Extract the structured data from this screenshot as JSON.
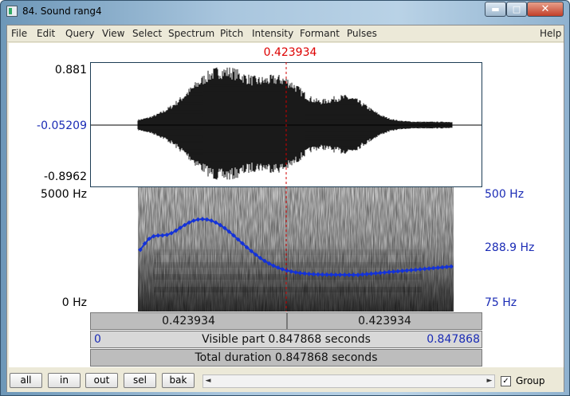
{
  "window": {
    "title": "84. Sound rang4",
    "minimize": "▬",
    "maximize": "□",
    "close": "✕"
  },
  "menu": [
    "File",
    "Edit",
    "Query",
    "View",
    "Select",
    "Spectrum",
    "Pitch",
    "Intensity",
    "Formant",
    "Pulses",
    "Help"
  ],
  "editor": {
    "cursor_time": "0.423934",
    "wave_max": "0.881",
    "wave_mid": "-0.05209",
    "wave_min": "-0.8962",
    "spec_top": "5000 Hz",
    "spec_bottom": "0 Hz",
    "pitch_top": "500 Hz",
    "pitch_mid": "288.9 Hz",
    "pitch_bottom": "75 Hz",
    "cursor_fraction": 0.5,
    "sound_start_fraction": 0.12,
    "sound_end_fraction": 0.925,
    "colors": {
      "cursor": "#d00000",
      "pitch": "#1432d8",
      "axis_right": "#1a2bb5"
    }
  },
  "bars": {
    "left_segment": "0.423934",
    "right_segment": "0.423934",
    "visible_start": "0",
    "visible_label": "Visible part 0.847868 seconds",
    "visible_end": "0.847868",
    "total_label": "Total duration 0.847868 seconds"
  },
  "bottom": {
    "buttons": [
      "all",
      "in",
      "out",
      "sel",
      "bak"
    ],
    "scroll_left": "◄",
    "scroll_right": "►",
    "group_checked": "✓",
    "group_label": "Group"
  }
}
